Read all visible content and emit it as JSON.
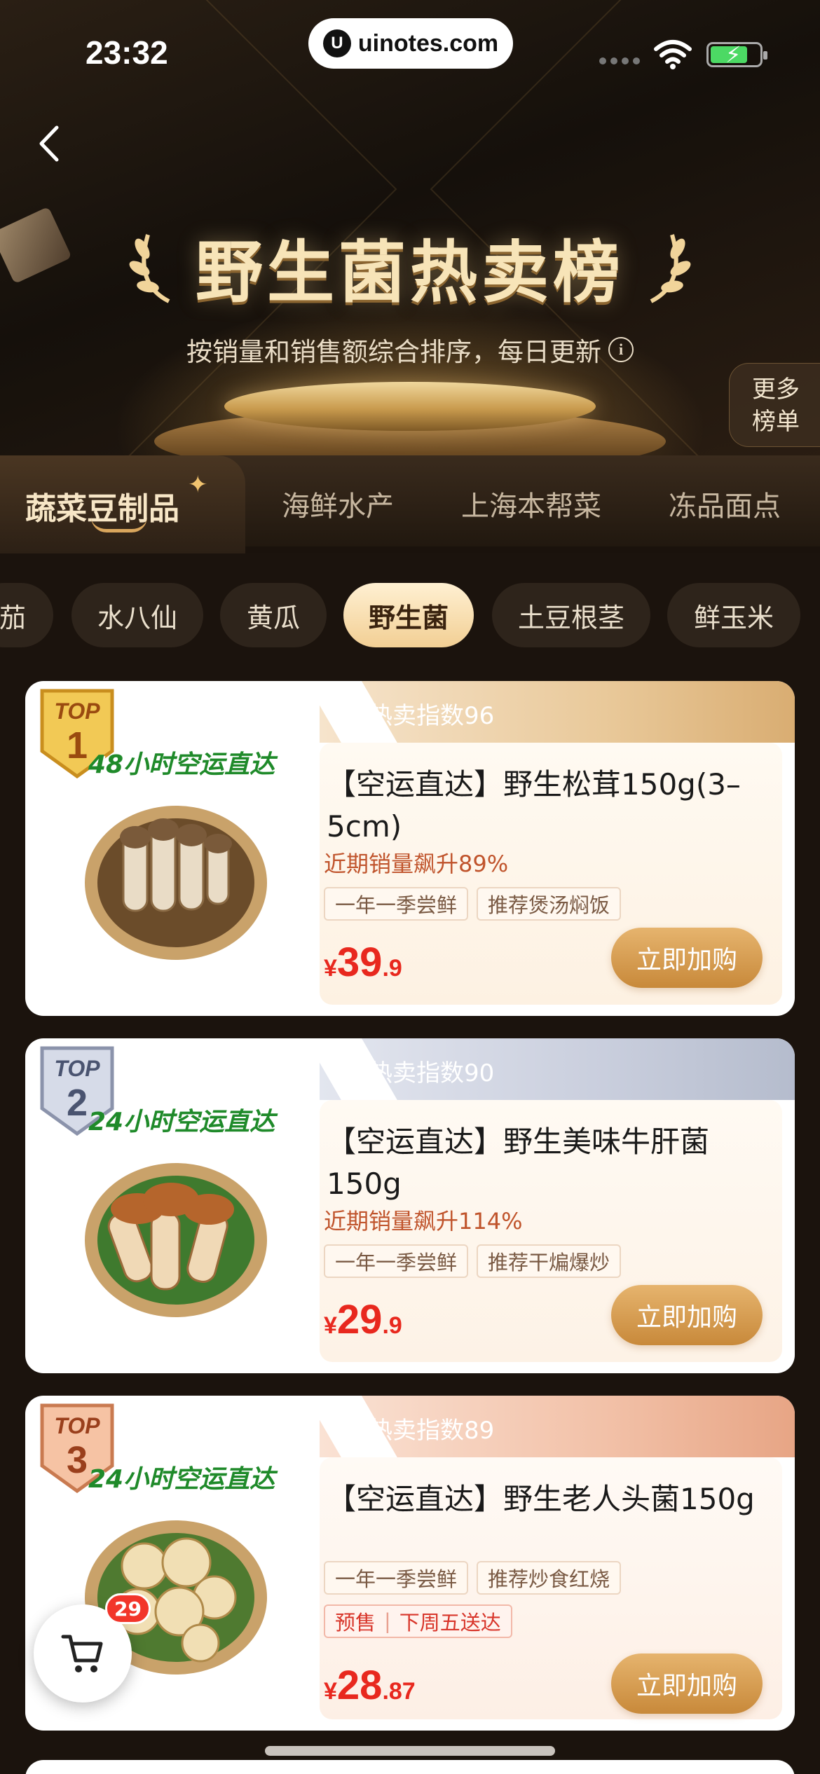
{
  "status_bar": {
    "time": "23:32",
    "url": "uinotes.com"
  },
  "header": {
    "title": "野生菌热卖榜",
    "subtitle": "按销量和销售额综合排序，每日更新",
    "more_line1": "更多",
    "more_line2": "榜单"
  },
  "category_tabs": [
    {
      "label": "蔬菜豆制品",
      "active": true
    },
    {
      "label": "海鲜水产",
      "active": false
    },
    {
      "label": "上海本帮菜",
      "active": false
    },
    {
      "label": "冻品面点",
      "active": false
    }
  ],
  "sub_chips": [
    {
      "label": "茄",
      "active": false
    },
    {
      "label": "水八仙",
      "active": false
    },
    {
      "label": "黄瓜",
      "active": false
    },
    {
      "label": "野生菌",
      "active": true
    },
    {
      "label": "土豆根茎",
      "active": false
    },
    {
      "label": "鲜玉米",
      "active": false
    }
  ],
  "products": [
    {
      "rank_label": "TOP",
      "rank": "1",
      "tier": "gold",
      "heat": "热卖指数96",
      "slogan": "48小时空运直达",
      "title": "【空运直达】野生松茸150g(3–5cm)",
      "trend": "近期销量飙升89%",
      "tags": [
        "一年一季尝鲜",
        "推荐煲汤焖饭"
      ],
      "price_symbol": "¥",
      "price_int": "39",
      "price_dec": ".9",
      "buy_label": "立即加购"
    },
    {
      "rank_label": "TOP",
      "rank": "2",
      "tier": "silver",
      "heat": "热卖指数90",
      "slogan": "24小时空运直达",
      "title": "【空运直达】野生美味牛肝菌150g",
      "trend": "近期销量飙升114%",
      "tags": [
        "一年一季尝鲜",
        "推荐干煸爆炒"
      ],
      "price_symbol": "¥",
      "price_int": "29",
      "price_dec": ".9",
      "buy_label": "立即加购"
    },
    {
      "rank_label": "TOP",
      "rank": "3",
      "tier": "bronze",
      "heat": "热卖指数89",
      "slogan": "24小时空运直达",
      "title": "【空运直达】野生老人头菌150g",
      "trend": "",
      "tags": [
        "一年一季尝鲜",
        "推荐炒食红烧"
      ],
      "presale": "预售",
      "presale_delivery": "下周五送达",
      "price_symbol": "¥",
      "price_int": "28",
      "price_dec": ".87",
      "buy_label": "立即加购"
    }
  ],
  "cart": {
    "count": "29"
  },
  "colors": {
    "gold_accent": "#d9ad72",
    "price_red": "#e8281e",
    "button_gold": "#c8893a",
    "background": "#1a120c"
  }
}
